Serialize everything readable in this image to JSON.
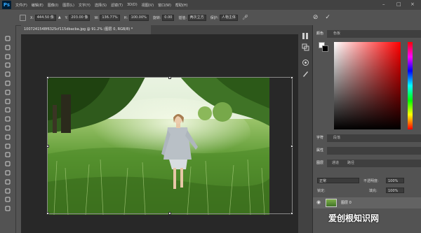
{
  "app": {
    "logo": "Ps"
  },
  "menu": [
    "文件(F)",
    "编辑(E)",
    "图像(I)",
    "图层(L)",
    "文字(Y)",
    "选择(S)",
    "滤镜(T)",
    "3D(D)",
    "视图(V)",
    "窗口(W)",
    "帮助(H)"
  ],
  "window_controls": {
    "minimize": "–",
    "maximize": "□",
    "close": "×"
  },
  "options_bar": {
    "x_label": "X:",
    "x_value": "444.50 像",
    "y_label": "Y:",
    "y_value": "203.00 像",
    "w_label": "W:",
    "w_value": "136.77%",
    "h_label": "H:",
    "h_value": "100.00%",
    "angle_label": "旋转:",
    "angle_value": "0.00",
    "interp_label": "插值:",
    "interp_value": "两次立方",
    "warp_label": "变形:",
    "protect_label": "保护:",
    "protect_value": "人物主体"
  },
  "document_tab": {
    "title": "1007241548f6325cf115dbacba.jpg @ 91.2% (图层 0, RGB/8) *",
    "close": "×"
  },
  "panels": {
    "color_tabs": [
      "颜色",
      "色板"
    ],
    "char_tabs": [
      "字符",
      "段落"
    ],
    "props_tab": "属性",
    "layer_tabs": [
      "图层",
      "通道",
      "路径"
    ],
    "blend_mode": "正常",
    "opacity_label": "不透明度:",
    "opacity_value": "100%",
    "lock_label": "锁定:",
    "fill_label": "填充:",
    "fill_value": "100%",
    "layer_name": "图层 0"
  },
  "watermark": "爱创根知识网",
  "colors": {
    "foreground": "#ffffff",
    "background": "#000000",
    "hue": "#ff0000"
  }
}
